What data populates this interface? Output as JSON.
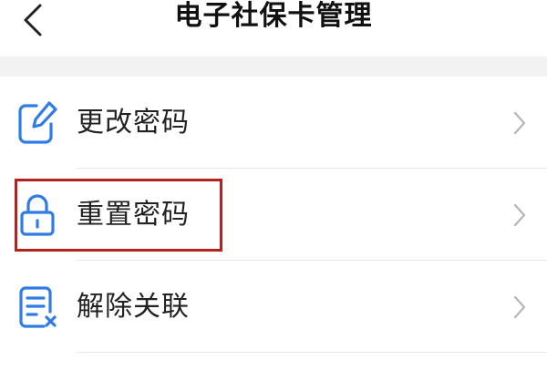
{
  "header": {
    "title": "电子社保卡管理",
    "back_icon": "chevron-left-icon"
  },
  "menu": {
    "items": [
      {
        "label": "更改密码",
        "icon": "edit-document-icon"
      },
      {
        "label": "重置密码",
        "icon": "lock-icon"
      },
      {
        "label": "解除关联",
        "icon": "unlink-document-icon"
      }
    ]
  },
  "annotation": {
    "highlight_color": "#b3221f",
    "highlighted_item": "重置密码"
  },
  "colors": {
    "icon_blue": "#2f7ce6",
    "chevron_gray": "#b5b5b5"
  }
}
